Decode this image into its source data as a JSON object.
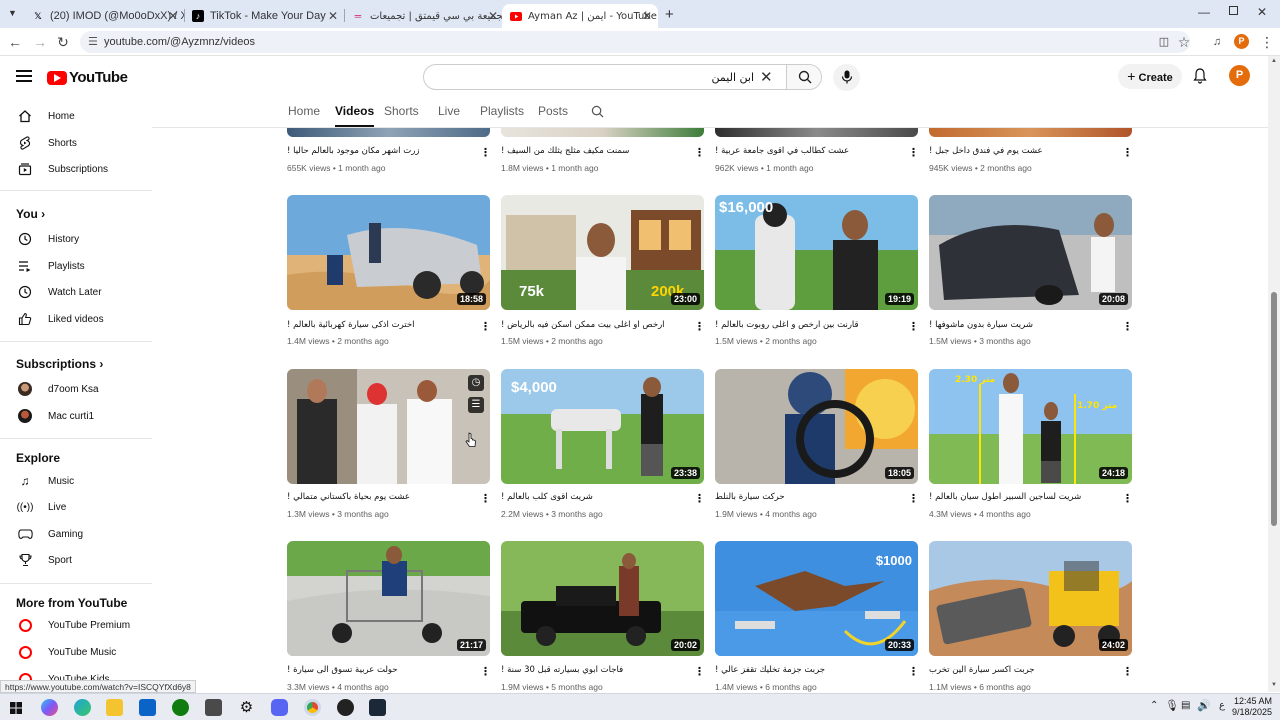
{
  "browser": {
    "tabs": [
      {
        "title": "(20) IMOD (@Mo0oDxX) / X",
        "favicon": "x-logo"
      },
      {
        "title": "TikTok - Make Your Day",
        "favicon": "tiktok-logo"
      },
      {
        "title": "تجميعة بي سي قيمتق | تجميعات",
        "favicon": "site-logo"
      },
      {
        "title": "Ayman Az | ايمن - YouTube",
        "favicon": "youtube-logo"
      }
    ],
    "url": "youtube.com/@Ayzmnz/videos",
    "status_url": "https://www.youtube.com/watch?v=ISCQYfXd6y8"
  },
  "header": {
    "logo_text": "YouTube",
    "search_value": "ابن اليمن",
    "create_label": "Create",
    "avatar_letter": "P"
  },
  "channel_tabs": [
    "Home",
    "Videos",
    "Shorts",
    "Live",
    "Playlists",
    "Posts"
  ],
  "sidebar": {
    "main": [
      "Home",
      "Shorts",
      "Subscriptions"
    ],
    "you_heading": "You",
    "you_items": [
      "History",
      "Playlists",
      "Watch Later",
      "Liked videos"
    ],
    "subs_heading": "Subscriptions",
    "subs_items": [
      "d7oom Ksa",
      "Mac curti1"
    ],
    "explore_heading": "Explore",
    "explore_items": [
      "Music",
      "Live",
      "Gaming",
      "Sport"
    ],
    "more_heading": "More from YouTube",
    "more_items": [
      "YouTube Premium",
      "YouTube Music",
      "YouTube Kids"
    ]
  },
  "videos": [
    {
      "title": "زرت اشهر مكان موجود بالعالم حاليا !",
      "views": "655K views",
      "age": "1 month ago"
    },
    {
      "title": "سمنت مكيف مثلج يثلك من السيف !",
      "views": "1.8M views",
      "age": "1 month ago"
    },
    {
      "title": "عشت كطالب في اقوى جامعة عربية !",
      "views": "962K views",
      "age": "1 month ago"
    },
    {
      "title": "عشت يوم في فندق داخل جبل !",
      "views": "945K views",
      "age": "2 months ago"
    },
    {
      "title": "اخترت اذكى سيارة كهربائية بالعالم !",
      "views": "1.4M views",
      "age": "2 months ago",
      "duration": "18:58"
    },
    {
      "title": "ارخص او اغلى بيت ممكن اسكن فيه بالرياض !",
      "views": "1.5M views",
      "age": "2 months ago",
      "duration": "23:00",
      "overlay": [
        "75k",
        "200k"
      ]
    },
    {
      "title": "قارنت بين ارخص و اغلى روبوت بالعالم !",
      "views": "1.5M views",
      "age": "2 months ago",
      "duration": "19:19",
      "overlay": [
        "$16,000"
      ]
    },
    {
      "title": "شريت سيارة بدون ماشوفها !",
      "views": "1.5M views",
      "age": "3 months ago",
      "duration": "20:08"
    },
    {
      "title": "عشت يوم بحياة باكستاني متمالي !",
      "views": "1.3M views",
      "age": "3 months ago"
    },
    {
      "title": "شريت اقوى كلب بالعالم !",
      "views": "2.2M views",
      "age": "3 months ago",
      "duration": "23:38",
      "overlay": [
        "$4,000"
      ]
    },
    {
      "title": "حركت سيارة بالنلط",
      "views": "1.9M views",
      "age": "4 months ago",
      "duration": "18:05"
    },
    {
      "title": "شريت لساجين السبير اطول سيان بالعالم !",
      "views": "4.3M views",
      "age": "4 months ago",
      "duration": "24:18",
      "overlay": [
        "2.30 متر",
        "1.70 متر"
      ]
    },
    {
      "title": "حولت عربية تسوق الى سيارة !",
      "views": "3.3M views",
      "age": "4 months ago",
      "duration": "21:17"
    },
    {
      "title": "فاجأت ابوي بسيارته قبل 30 سنة !",
      "views": "1.9M views",
      "age": "5 months ago",
      "duration": "20:02"
    },
    {
      "title": "جربت جزمة تخليك تقفز عالي !",
      "views": "1.4M views",
      "age": "6 months ago",
      "duration": "20:33",
      "overlay": [
        "$1000"
      ]
    },
    {
      "title": "جربت اكسر سيارة الين تخرب",
      "views": "1.1M views",
      "age": "6 months ago",
      "duration": "24:02"
    }
  ],
  "taskbar": {
    "time": "12:45 AM",
    "date": "9/18/2025",
    "lang": "ع"
  },
  "colors": {
    "youtube_red": "#ff0000",
    "avatar": "#e46c0a",
    "scrollbar": "#8b8b8b"
  }
}
